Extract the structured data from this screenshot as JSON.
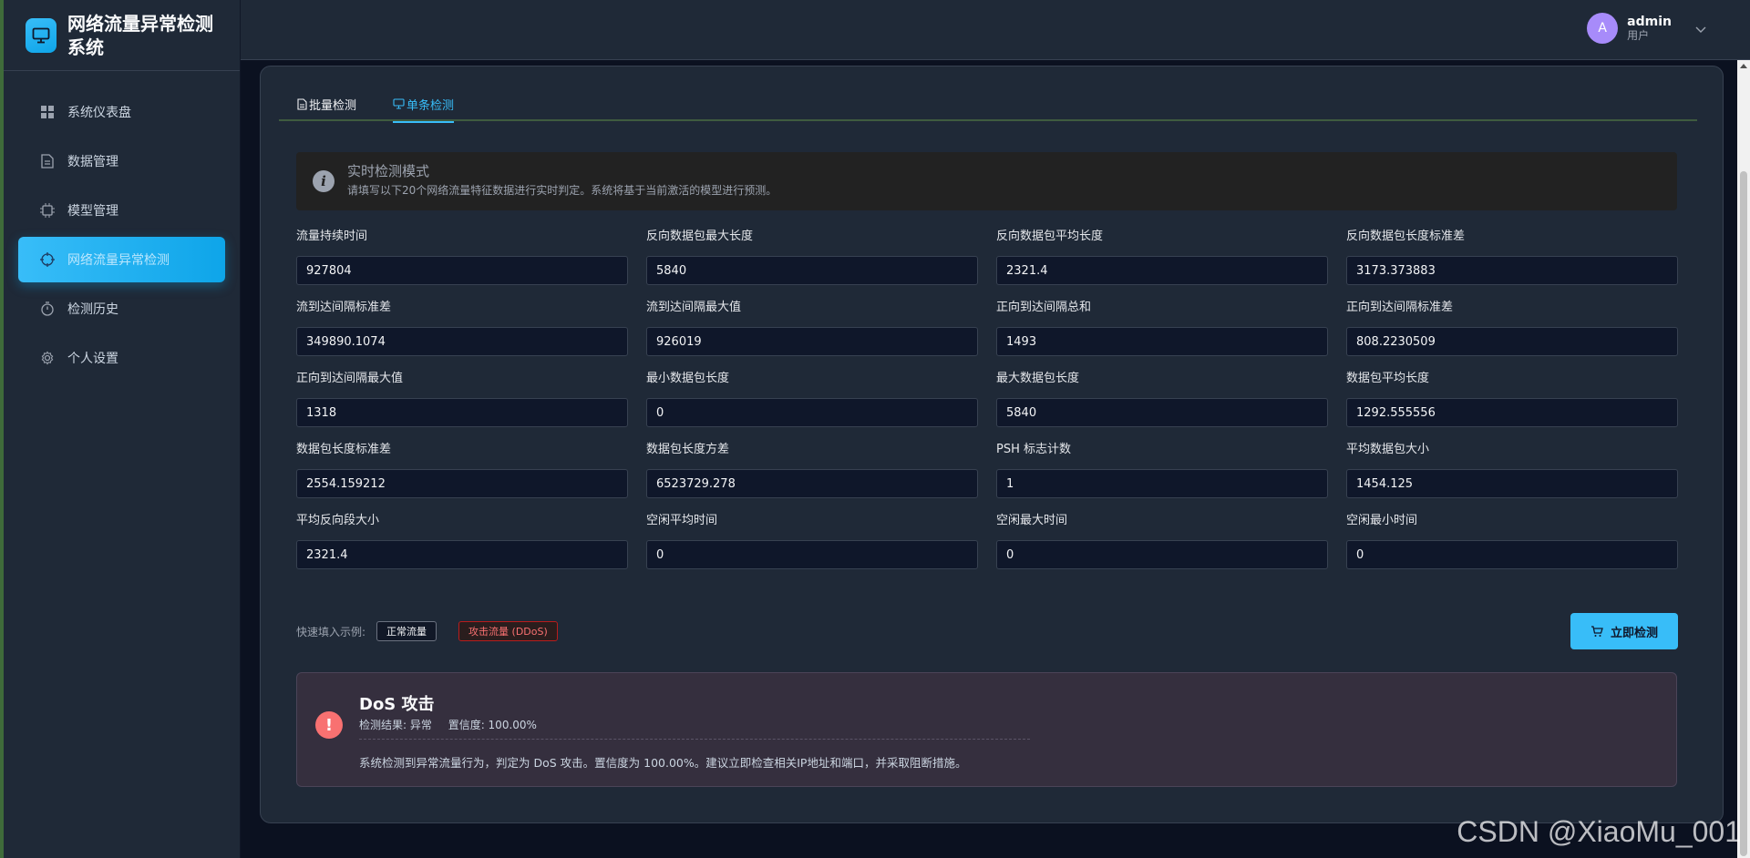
{
  "app": {
    "title": "网络流量异常检测系统"
  },
  "sidebar": {
    "items": [
      {
        "label": "系统仪表盘",
        "icon": "grid-icon",
        "active": false
      },
      {
        "label": "数据管理",
        "icon": "document-icon",
        "active": false
      },
      {
        "label": "模型管理",
        "icon": "chip-icon",
        "active": false
      },
      {
        "label": "网络流量异常检测",
        "icon": "target-icon",
        "active": true
      },
      {
        "label": "检测历史",
        "icon": "stopwatch-icon",
        "active": false
      },
      {
        "label": "个人设置",
        "icon": "gear-icon",
        "active": false
      }
    ]
  },
  "header": {
    "user": {
      "avatar_letter": "A",
      "name": "admin",
      "role": "用户"
    }
  },
  "tabs": [
    {
      "label": "批量检测",
      "active": false
    },
    {
      "label": "单条检测",
      "active": true
    }
  ],
  "alert": {
    "title": "实时检测模式",
    "description": "请填写以下20个网络流量特征数据进行实时判定。系统将基于当前激活的模型进行预测。"
  },
  "fields": [
    {
      "label": "流量持续时间",
      "value": "927804"
    },
    {
      "label": "反向数据包最大长度",
      "value": "5840"
    },
    {
      "label": "反向数据包平均长度",
      "value": "2321.4"
    },
    {
      "label": "反向数据包长度标准差",
      "value": "3173.373883"
    },
    {
      "label": "流到达间隔标准差",
      "value": "349890.1074"
    },
    {
      "label": "流到达间隔最大值",
      "value": "926019"
    },
    {
      "label": "正向到达间隔总和",
      "value": "1493"
    },
    {
      "label": "正向到达间隔标准差",
      "value": "808.2230509"
    },
    {
      "label": "正向到达间隔最大值",
      "value": "1318"
    },
    {
      "label": "最小数据包长度",
      "value": "0"
    },
    {
      "label": "最大数据包长度",
      "value": "5840"
    },
    {
      "label": "数据包平均长度",
      "value": "1292.555556"
    },
    {
      "label": "数据包长度标准差",
      "value": "2554.159212"
    },
    {
      "label": "数据包长度方差",
      "value": "6523729.278"
    },
    {
      "label": "PSH 标志计数",
      "value": "1"
    },
    {
      "label": "平均数据包大小",
      "value": "1454.125"
    },
    {
      "label": "平均反向段大小",
      "value": "2321.4"
    },
    {
      "label": "空闲平均时间",
      "value": "0"
    },
    {
      "label": "空闲最大时间",
      "value": "0"
    },
    {
      "label": "空闲最小时间",
      "value": "0"
    }
  ],
  "quick_fill": {
    "label": "快速填入示例:",
    "normal_label": "正常流量",
    "ddos_label": "攻击流量 (DDoS)"
  },
  "detect_button": {
    "label": "立即检测"
  },
  "result": {
    "title": "DoS 攻击",
    "status_text": "检测结果: 异常",
    "confidence_text": "置信度: 100.00%",
    "description": "系统检测到异常流量行为，判定为 DoS 攻击。置信度为 100.00%。建议立即检查相关IP地址和端口，并采取阻断措施。"
  },
  "watermark": "CSDN @XiaoMu_001",
  "colors": {
    "accent": "#38bdf8",
    "danger": "#f87171",
    "background": "#0b1120",
    "panel": "#1f2937"
  }
}
